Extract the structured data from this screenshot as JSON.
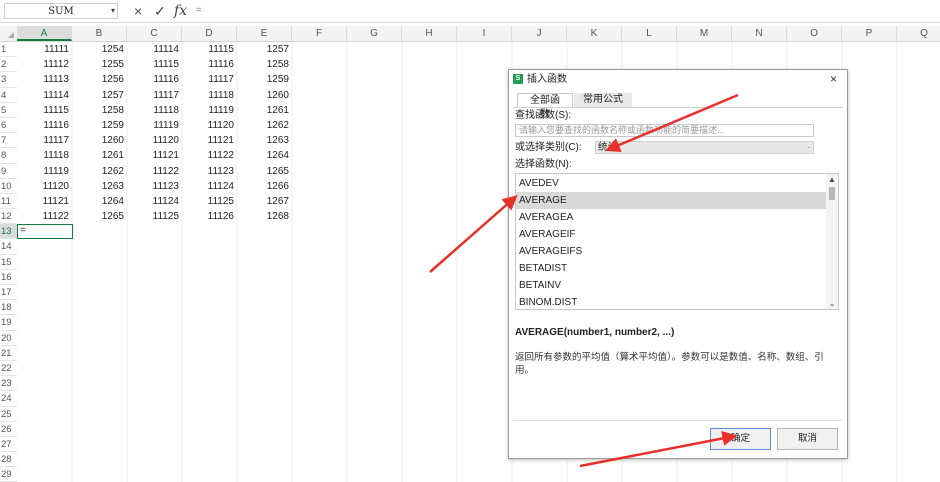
{
  "formula_bar": {
    "name_box": "SUM",
    "cancel_icon": "×",
    "confirm_icon": "✓",
    "fx_label": "fx",
    "formula": "="
  },
  "columns": [
    "A",
    "B",
    "C",
    "D",
    "E",
    "F",
    "G",
    "H",
    "I",
    "J",
    "K",
    "L",
    "M",
    "N",
    "O",
    "P",
    "Q"
  ],
  "rows": [
    "1",
    "2",
    "3",
    "4",
    "5",
    "6",
    "7",
    "8",
    "9",
    "10",
    "11",
    "12",
    "13",
    "14",
    "15",
    "16",
    "17",
    "18",
    "19",
    "20",
    "21",
    "22",
    "23",
    "24",
    "25",
    "26",
    "27",
    "28",
    "29"
  ],
  "cells": [
    [
      "11111",
      "1254",
      "11114",
      "11115",
      "1257"
    ],
    [
      "11112",
      "1255",
      "11115",
      "11116",
      "1258"
    ],
    [
      "11113",
      "1256",
      "11116",
      "11117",
      "1259"
    ],
    [
      "11114",
      "1257",
      "11117",
      "11118",
      "1260"
    ],
    [
      "11115",
      "1258",
      "11118",
      "11119",
      "1261"
    ],
    [
      "11116",
      "1259",
      "11119",
      "11120",
      "1262"
    ],
    [
      "11117",
      "1260",
      "11120",
      "11121",
      "1263"
    ],
    [
      "11118",
      "1261",
      "11121",
      "11122",
      "1264"
    ],
    [
      "11119",
      "1262",
      "11122",
      "11123",
      "1265"
    ],
    [
      "11120",
      "1263",
      "11123",
      "11124",
      "1266"
    ],
    [
      "11121",
      "1264",
      "11124",
      "11125",
      "1267"
    ],
    [
      "11122",
      "1265",
      "11125",
      "11126",
      "1268"
    ]
  ],
  "active_cell_text": "=",
  "dialog": {
    "logo": "S",
    "title": "插入函数",
    "close_icon": "×",
    "tabs": [
      "全部函数",
      "常用公式"
    ],
    "search_label": "查找函数(S):",
    "search_placeholder": "请输入您要查找的函数名称或函数功能的简要描述...",
    "category_label": "或选择类别(C):",
    "category_value": "统计",
    "category_arrow": "·",
    "select_label": "选择函数(N):",
    "functions": [
      "AVEDEV",
      "AVERAGE",
      "AVERAGEA",
      "AVERAGEIF",
      "AVERAGEIFS",
      "BETADIST",
      "BETAINV",
      "BINOM.DIST"
    ],
    "selected_function": "AVERAGE",
    "scroll_up_icon": "▲",
    "scroll_down_icon": "⌄",
    "signature": "AVERAGE(number1, number2, ...)",
    "description": "返回所有参数的平均值（算术平均值）。参数可以是数值、名称、数组、引用。",
    "ok_label": "确定",
    "cancel_label": "取消"
  },
  "colors": {
    "accent_green": "#107c41",
    "annotation_red": "#e8302a"
  }
}
